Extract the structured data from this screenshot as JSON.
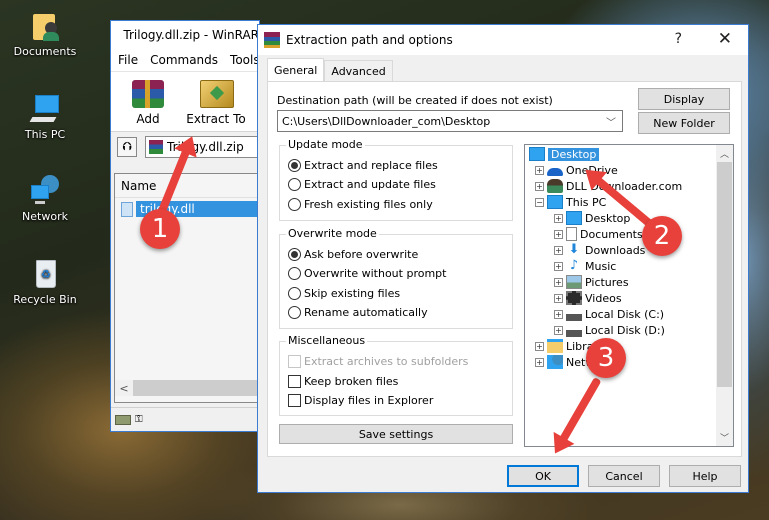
{
  "desktop": {
    "icons": [
      {
        "label": "Documents",
        "icon": "user-folder-icon"
      },
      {
        "label": "This PC",
        "icon": "computer-icon"
      },
      {
        "label": "Network",
        "icon": "network-icon"
      },
      {
        "label": "Recycle Bin",
        "icon": "recycle-bin-icon"
      }
    ]
  },
  "winrar": {
    "title": "Trilogy.dll.zip - WinRAR",
    "menu": [
      "File",
      "Commands",
      "Tools"
    ],
    "toolbar": [
      {
        "label": "Add",
        "icon": "add-archive-icon"
      },
      {
        "label": "Extract To",
        "icon": "extract-to-icon"
      }
    ],
    "address": "Trilogy.dll.zip",
    "list_header": "Name",
    "files": [
      {
        "name": "trilogy.dll",
        "selected": true
      }
    ]
  },
  "dialog": {
    "title": "Extraction path and options",
    "help_label": "?",
    "close_label": "✕",
    "tabs": [
      {
        "label": "General",
        "active": true
      },
      {
        "label": "Advanced",
        "active": false
      }
    ],
    "destination_label": "Destination path (will be created if does not exist)",
    "destination_value": "C:\\Users\\DllDownloader_com\\Desktop",
    "display_button": "Display",
    "new_folder_button": "New Folder",
    "update_mode": {
      "title": "Update mode",
      "options": [
        {
          "label": "Extract and replace files",
          "selected": true
        },
        {
          "label": "Extract and update files",
          "selected": false
        },
        {
          "label": "Fresh existing files only",
          "selected": false
        }
      ]
    },
    "overwrite_mode": {
      "title": "Overwrite mode",
      "options": [
        {
          "label": "Ask before overwrite",
          "selected": true
        },
        {
          "label": "Overwrite without prompt",
          "selected": false
        },
        {
          "label": "Skip existing files",
          "selected": false
        },
        {
          "label": "Rename automatically",
          "selected": false
        }
      ]
    },
    "miscellaneous": {
      "title": "Miscellaneous",
      "options": [
        {
          "label": "Extract archives to subfolders",
          "checked": false,
          "disabled": true
        },
        {
          "label": "Keep broken files",
          "checked": false,
          "disabled": false
        },
        {
          "label": "Display files in Explorer",
          "checked": false,
          "disabled": false
        }
      ]
    },
    "save_settings_button": "Save settings",
    "tree": [
      {
        "label": "Desktop",
        "level": 0,
        "expander": "",
        "selected": true,
        "icon": "desktop-icon"
      },
      {
        "label": "OneDrive",
        "level": 1,
        "expander": "+",
        "selected": false,
        "icon": "onedrive-icon"
      },
      {
        "label": "DLL Downloader.com",
        "level": 1,
        "expander": "+",
        "selected": false,
        "icon": "user-icon"
      },
      {
        "label": "This PC",
        "level": 1,
        "expander": "−",
        "selected": false,
        "icon": "computer-icon"
      },
      {
        "label": "Desktop",
        "level": 2,
        "expander": "+",
        "selected": false,
        "icon": "desktop-icon"
      },
      {
        "label": "Documents",
        "level": 2,
        "expander": "+",
        "selected": false,
        "icon": "documents-icon"
      },
      {
        "label": "Downloads",
        "level": 2,
        "expander": "+",
        "selected": false,
        "icon": "downloads-icon"
      },
      {
        "label": "Music",
        "level": 2,
        "expander": "+",
        "selected": false,
        "icon": "music-icon"
      },
      {
        "label": "Pictures",
        "level": 2,
        "expander": "+",
        "selected": false,
        "icon": "pictures-icon"
      },
      {
        "label": "Videos",
        "level": 2,
        "expander": "+",
        "selected": false,
        "icon": "videos-icon"
      },
      {
        "label": "Local Disk (C:)",
        "level": 2,
        "expander": "+",
        "selected": false,
        "icon": "drive-c-icon"
      },
      {
        "label": "Local Disk (D:)",
        "level": 2,
        "expander": "+",
        "selected": false,
        "icon": "drive-d-icon"
      },
      {
        "label": "Libraries",
        "level": 1,
        "expander": "+",
        "selected": false,
        "icon": "libraries-icon"
      },
      {
        "label": "Network",
        "level": 1,
        "expander": "+",
        "selected": false,
        "icon": "network-icon"
      }
    ],
    "ok_button": "OK",
    "cancel_button": "Cancel",
    "help_button": "Help"
  },
  "annotations": [
    {
      "number": "1",
      "target": "Extract To"
    },
    {
      "number": "2",
      "target": "Desktop"
    },
    {
      "number": "3",
      "target": "OK"
    }
  ],
  "colors": {
    "accent": "#0078d7",
    "selection": "#3393df",
    "annotation": "#e8403a"
  }
}
